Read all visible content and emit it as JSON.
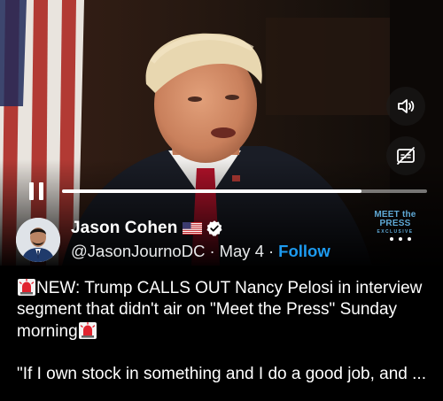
{
  "video": {
    "progress_fraction": 0.82,
    "watermark_main": "MEET the PRESS",
    "watermark_sub": "EXCLUSIVE"
  },
  "author": {
    "name": "Jason Cohen",
    "handle": "@JasonJournoDC",
    "separator": "·",
    "date": "May 4",
    "follow_label": "Follow",
    "flag_icon": "us-flag-icon",
    "verified_icon": "verified-badge-icon"
  },
  "tweet": {
    "line1": "NEW: Trump CALLS OUT Nancy Pelosi in interview segment that didn't air on \"Meet the Press\" Sunday morning",
    "quote": "\"If I own stock in something and I do a good job, and ..."
  },
  "colors": {
    "background": "#000000",
    "text": "#ffffff",
    "link": "#1d9bf0",
    "verified_badge": "#ffffff",
    "watermark": "#5fa9d6"
  }
}
